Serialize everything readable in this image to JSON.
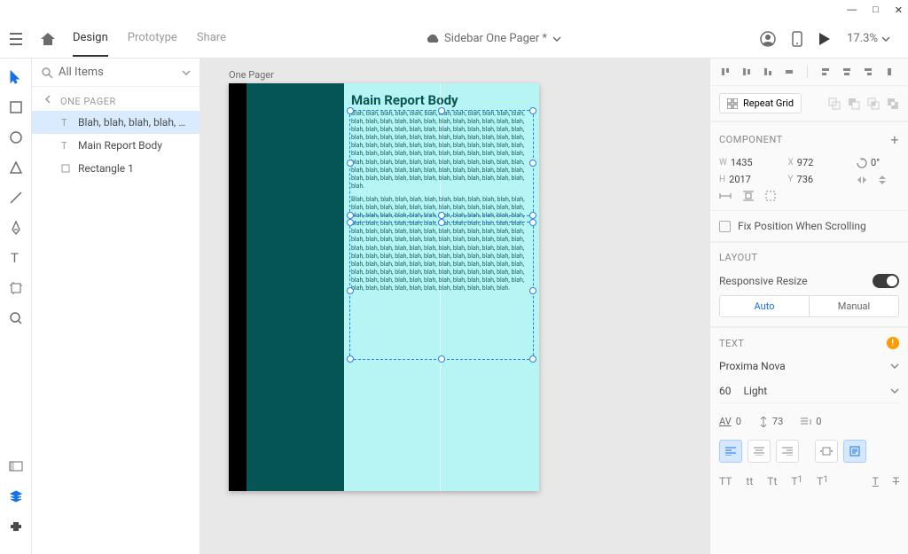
{
  "topbar": {
    "tabs": {
      "design": "Design",
      "prototype": "Prototype",
      "share": "Share"
    },
    "doc_title": "Sidebar One Pager *",
    "zoom": "17.3%"
  },
  "layers": {
    "search_label": "All Items",
    "group_title": "ONE PAGER",
    "items": [
      {
        "label": "Blah, blah, blah, blah, blah, blah,..."
      },
      {
        "label": "Main Report Body"
      },
      {
        "label": "Rectangle 1"
      }
    ]
  },
  "canvas": {
    "artboard_label": "One Pager",
    "report_title": "Main Report Body",
    "para1": "Blah, blah, blah, blah, blah, blah, blah, blah, blah, blah, blah, blah, blah, blah, blah, blah, blah, blah, blah, blah, blah, blah, blah, blah, blah, blah, blah, blah, blah, blah, blah, blah, blah, blah, blah, blah, blah, blah, blah, blah, blah, blah, blah, blah, blah, blah, blah, blah, blah, blah, blah, blah, blah, blah, blah, blah, blah, blah, blah, blah, blah, blah, blah, blah, blah, blah, blah, blah, blah, blah, blah, blah, blah, blah, blah, blah, blah, blah, blah, blah, blah, blah, blah, blah, blah, blah, blah, blah, blah, blah, blah, blah, blah, blah, blah, blah, blah, blah, blah, blah, blah, blah, blah, blah, blah, blah, blah, blah, blah.",
    "para2": "Blah, blah, blah, blah, blah, blah, blah, blah, blah, blah, blah, blah, blah, blah, blah, blah, blah, blah, blah, blah, blah, blah, blah, blah, blah, blah, blah, blah, blah, blah, blah, blah, blah, blah, blah, blah, blah, blah, blah, blah, blah, blah, blah, blah, blah, blah, blah, blah, blah, blah, blah, blah, blah, blah, blah, blah, blah, blah, blah, blah, blah, blah, blah, blah, blah, blah, blah, blah, blah, blah, blah, blah, blah, blah, blah, blah, blah, blah, blah, blah, blah, blah, blah, blah, blah, blah, blah, blah, blah, blah, blah, blah, blah, blah, blah, blah, blah, blah, blah, blah, blah, blah, blah, blah, blah, blah, blah, blah, blah, blah, blah, blah, blah, blah, blah, blah, blah, blah, blah, blah, blah, blah, blah, blah, blah, blah, blah, blah, blah, blah, blah, blah, blah, blah, blah, blah, blah, blah, blah, blah, blah, blah, blah."
  },
  "inspector": {
    "repeat_grid": "Repeat Grid",
    "component_title": "COMPONENT",
    "transform": {
      "w": "1435",
      "x": "972",
      "h": "2017",
      "y": "736",
      "rot": "0°"
    },
    "fix_position": "Fix Position When Scrolling",
    "layout_title": "LAYOUT",
    "responsive_resize": "Responsive Resize",
    "auto": "Auto",
    "manual": "Manual",
    "text_title": "TEXT",
    "font_family": "Proxima Nova",
    "font_size": "60",
    "font_weight": "Light",
    "char_sp": "0",
    "line_sp": "73",
    "para_sp": "0",
    "cases": {
      "upper": "TT",
      "lower": "tt",
      "title": "Tt",
      "sup": "T",
      "supn": "1",
      "sub": "T",
      "subn": "1"
    }
  }
}
